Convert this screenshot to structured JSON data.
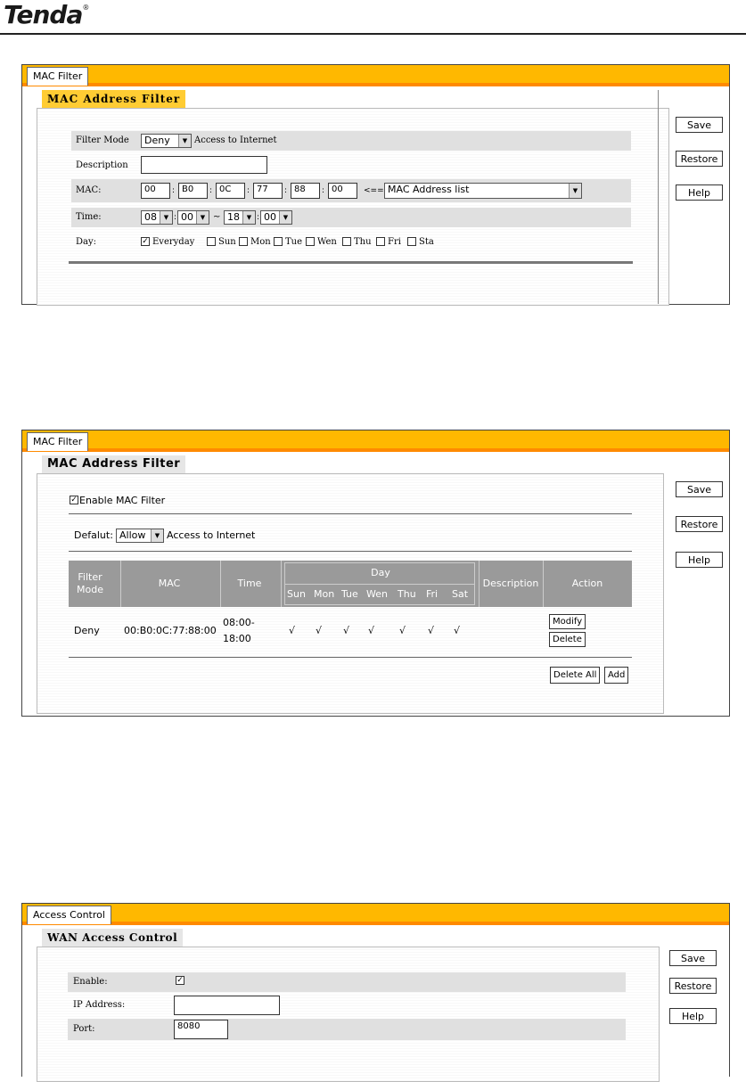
{
  "header": {
    "logo_text": "Tenda",
    "logo_mark": "®"
  },
  "panel1": {
    "tab": "MAC Filter",
    "subtitle": "MAC Address Filter",
    "buttons": {
      "save": "Save",
      "restore": "Restore",
      "help": "Help"
    },
    "filter_mode_label": "Filter Mode",
    "filter_mode_value": "Deny",
    "filter_mode_suffix": "Access to Internet",
    "description_label": "Description",
    "description_value": "",
    "mac_label": "MAC:",
    "mac_parts": [
      "00",
      "B0",
      "0C",
      "77",
      "88",
      "00"
    ],
    "mac_arrow": "<==",
    "mac_list": "MAC Address list",
    "time_label": "Time:",
    "time_start_h": "08",
    "time_start_m": "00",
    "time_sep": "~",
    "time_end_h": "18",
    "time_end_m": "00",
    "day_label": "Day:",
    "days": [
      "Everyday",
      "Sun",
      "Mon",
      "Tue",
      "Wen",
      "Thu",
      "Fri",
      "Sta"
    ],
    "days_checked": [
      true,
      false,
      false,
      false,
      false,
      false,
      false,
      false
    ]
  },
  "panel2": {
    "tab": "MAC Filter",
    "subtitle": "MAC Address Filter",
    "buttons": {
      "save": "Save",
      "restore": "Restore",
      "help": "Help"
    },
    "enable_label": "Enable MAC Filter",
    "enable_checked": true,
    "default_label": "Defalut:",
    "default_value": "Allow",
    "default_suffix": "Access to Internet",
    "table": {
      "headers": {
        "filter_mode": "Filter Mode",
        "mac": "MAC",
        "time": "Time",
        "day": "Day",
        "description": "Description",
        "action": "Action"
      },
      "day_headers": [
        "Sun",
        "Mon",
        "Tue",
        "Wen",
        "Thu",
        "Fri",
        "Sat"
      ],
      "rows": [
        {
          "mode": "Deny",
          "mac": "00:B0:0C:77:88:00",
          "time_start": "08:00-",
          "time_end": "18:00",
          "days": [
            "√",
            "√",
            "√",
            "√",
            "√",
            "√",
            "√"
          ],
          "description": "",
          "modify": "Modify",
          "delete": "Delete"
        }
      ]
    },
    "delete_all": "Delete All",
    "add": "Add"
  },
  "panel3": {
    "tab": "Access Control",
    "subtitle": "WAN Access Control",
    "buttons": {
      "save": "Save",
      "restore": "Restore",
      "help": "Help"
    },
    "enable_label": "Enable:",
    "enable_checked": true,
    "ip_label": "IP Address:",
    "ip_value": "",
    "port_label": "Port:",
    "port_value": "8080"
  },
  "icons": {
    "checkbox_check": "✓",
    "dropdown": "▼"
  }
}
